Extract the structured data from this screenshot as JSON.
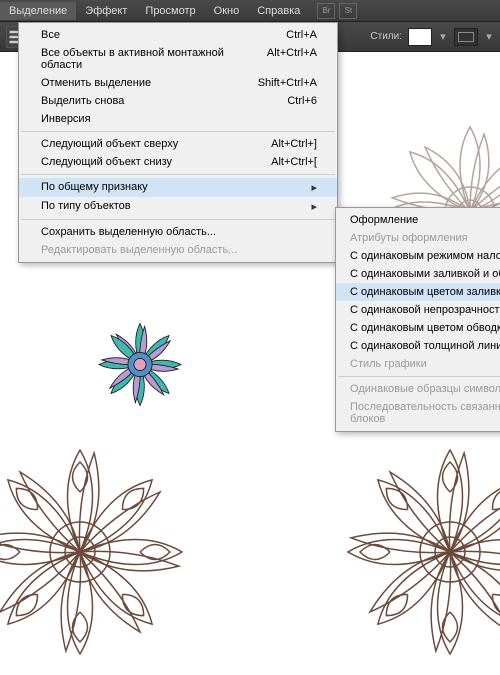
{
  "menubar": {
    "items": [
      "Выделение",
      "Эффект",
      "Просмотр",
      "Окно",
      "Справка"
    ],
    "activeIndex": 0,
    "iconLabels": [
      "Br",
      "St"
    ]
  },
  "toolbar": {
    "stylesLabel": "Стили:"
  },
  "dropdown": {
    "groups": [
      [
        {
          "label": "Все",
          "shortcut": "Ctrl+A"
        },
        {
          "label": "Все объекты в активной монтажной области",
          "shortcut": "Alt+Ctrl+A"
        },
        {
          "label": "Отменить выделение",
          "shortcut": "Shift+Ctrl+A"
        },
        {
          "label": "Выделить снова",
          "shortcut": "Ctrl+6"
        },
        {
          "label": "Инверсия",
          "shortcut": ""
        }
      ],
      [
        {
          "label": "Следующий объект сверху",
          "shortcut": "Alt+Ctrl+]"
        },
        {
          "label": "Следующий объект снизу",
          "shortcut": "Alt+Ctrl+["
        }
      ],
      [
        {
          "label": "По общему признаку",
          "shortcut": "",
          "submenu": true,
          "highlighted": true
        },
        {
          "label": "По типу объектов",
          "shortcut": "",
          "submenu": true
        }
      ],
      [
        {
          "label": "Сохранить выделенную область...",
          "shortcut": ""
        },
        {
          "label": "Редактировать выделенную область...",
          "shortcut": "",
          "disabled": true
        }
      ]
    ]
  },
  "submenu": {
    "groups": [
      [
        {
          "label": "Оформление"
        },
        {
          "label": "Атрибуты оформления",
          "disabled": true
        },
        {
          "label": "С одинаковым режимом наложения"
        },
        {
          "label": "С одинаковыми заливкой и обводкой"
        },
        {
          "label": "С одинаковым цветом заливки",
          "highlighted": true
        },
        {
          "label": "С одинаковой непрозрачностью"
        },
        {
          "label": "С одинаковым цветом обводки"
        },
        {
          "label": "С одинаковой толщиной линий"
        },
        {
          "label": "Стиль графики",
          "disabled": true
        }
      ],
      [
        {
          "label": "Одинаковые образцы символа",
          "disabled": true
        },
        {
          "label": "Последовательность связанных блоков",
          "disabled": true
        }
      ]
    ]
  },
  "artwork": {
    "colors": {
      "teal": "#3fb8b0",
      "purple": "#b89bd4",
      "pink": "#e0a0c0",
      "blue": "#5090c8",
      "outline": "#6b4a3a"
    }
  }
}
